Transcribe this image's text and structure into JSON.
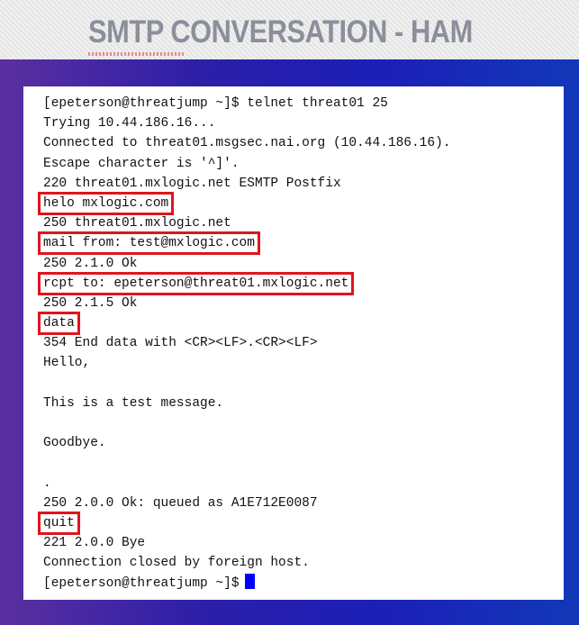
{
  "slide": {
    "title": "SMTP CONVERSATION - HAM"
  },
  "terminal": {
    "lines": [
      {
        "text": "[epeterson@threatjump ~]$ telnet threat01 25",
        "highlighted": false
      },
      {
        "text": "Trying 10.44.186.16...",
        "highlighted": false
      },
      {
        "text": "Connected to threat01.msgsec.nai.org (10.44.186.16).",
        "highlighted": false
      },
      {
        "text": "Escape character is '^]'.",
        "highlighted": false
      },
      {
        "text": "220 threat01.mxlogic.net ESMTP Postfix",
        "highlighted": false
      },
      {
        "text": "helo mxlogic.com",
        "highlighted": true
      },
      {
        "text": "250 threat01.mxlogic.net",
        "highlighted": false
      },
      {
        "text": "mail from: test@mxlogic.com",
        "highlighted": true
      },
      {
        "text": "250 2.1.0 Ok",
        "highlighted": false
      },
      {
        "text": "rcpt to: epeterson@threat01.mxlogic.net",
        "highlighted": true
      },
      {
        "text": "250 2.1.5 Ok",
        "highlighted": false
      },
      {
        "text": "data",
        "highlighted": true
      },
      {
        "text": "354 End data with <CR><LF>.<CR><LF>",
        "highlighted": false
      },
      {
        "text": "Hello,",
        "highlighted": false
      },
      {
        "text": "",
        "highlighted": false
      },
      {
        "text": "This is a test message.",
        "highlighted": false
      },
      {
        "text": "",
        "highlighted": false
      },
      {
        "text": "Goodbye.",
        "highlighted": false
      },
      {
        "text": "",
        "highlighted": false
      },
      {
        "text": ".",
        "highlighted": false
      },
      {
        "text": "250 2.0.0 Ok: queued as A1E712E0087",
        "highlighted": false
      },
      {
        "text": "quit",
        "highlighted": true
      },
      {
        "text": "221 2.0.0 Bye",
        "highlighted": false
      },
      {
        "text": "Connection closed by foreign host.",
        "highlighted": false
      },
      {
        "text": "[epeterson@threatjump ~]$",
        "highlighted": false,
        "cursor": true
      }
    ],
    "highlight_color": "#e0141e",
    "cursor_color": "#0000ff"
  }
}
